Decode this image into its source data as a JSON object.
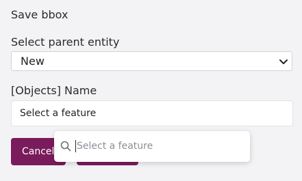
{
  "dialog": {
    "title": "Save bbox"
  },
  "parent_entity": {
    "label": "Select parent entity",
    "selected": "New"
  },
  "name_field": {
    "label": "[Objects] Name",
    "value": "Select a feature"
  },
  "buttons": {
    "cancel": "Cancel",
    "save": ""
  },
  "feature_search": {
    "placeholder": "Select a feature",
    "icon": "search-icon"
  },
  "colors": {
    "accent": "#7a1b5c",
    "background": "#f3f3f6"
  }
}
